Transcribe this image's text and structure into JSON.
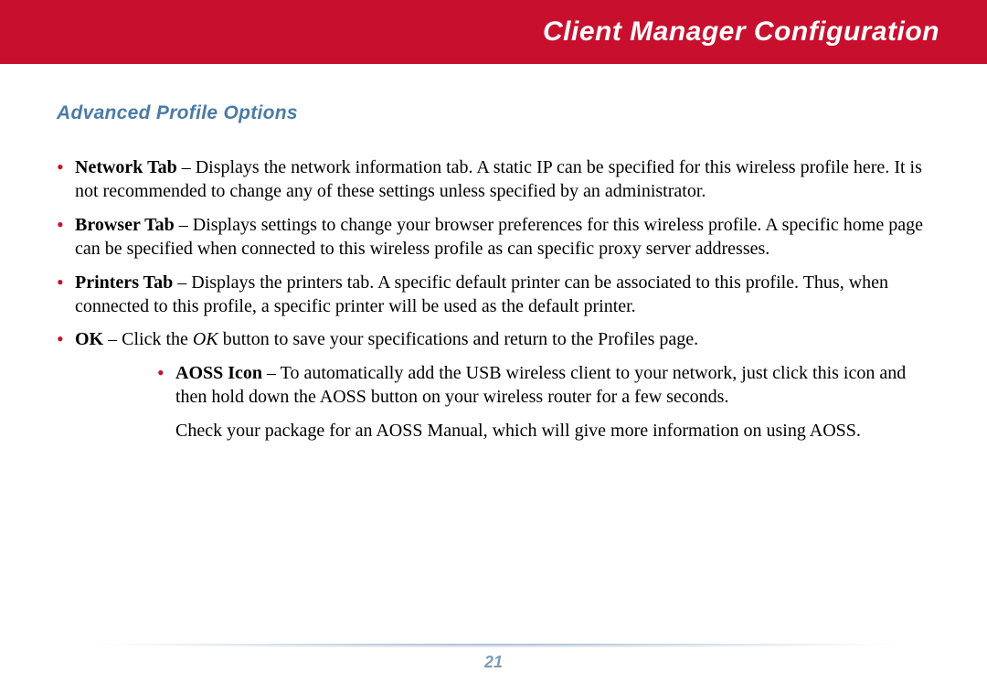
{
  "header": {
    "title": "Client Manager Configuration"
  },
  "section": {
    "title": "Advanced Profile Options"
  },
  "items": [
    {
      "label": "Network Tab",
      "sep": " –  ",
      "text": "Displays the network information tab.  A static IP can be specified for this wireless profile here.  It is not recommended to change any of these settings unless specified by an administrator."
    },
    {
      "label": "Browser Tab",
      "sep": " –  ",
      "text": "Displays settings to change your browser preferences for this wireless profile.  A specific home page can be specified when connected to this wireless profile as can specific proxy server addresses."
    },
    {
      "label": "Printers Tab",
      "sep": " –  ",
      "text": "Displays the printers tab.  A specific default printer can be associated to this profile.  Thus, when connected to this profile, a specific printer will be used as the default printer."
    },
    {
      "label": "OK",
      "sep": " – ",
      "pre": "Click the ",
      "italic": "OK",
      "post": " button to save your specifications and return to the Profiles page."
    }
  ],
  "nested": {
    "label": "AOSS Icon",
    "sep": " –  ",
    "text": "To automatically add the USB wireless client to your network, just click this icon and then hold down the AOSS button on your wireless router for a few seconds.",
    "follow": "Check your package for an AOSS Manual, which will give more information on using AOSS."
  },
  "footer": {
    "page_number": "21"
  }
}
